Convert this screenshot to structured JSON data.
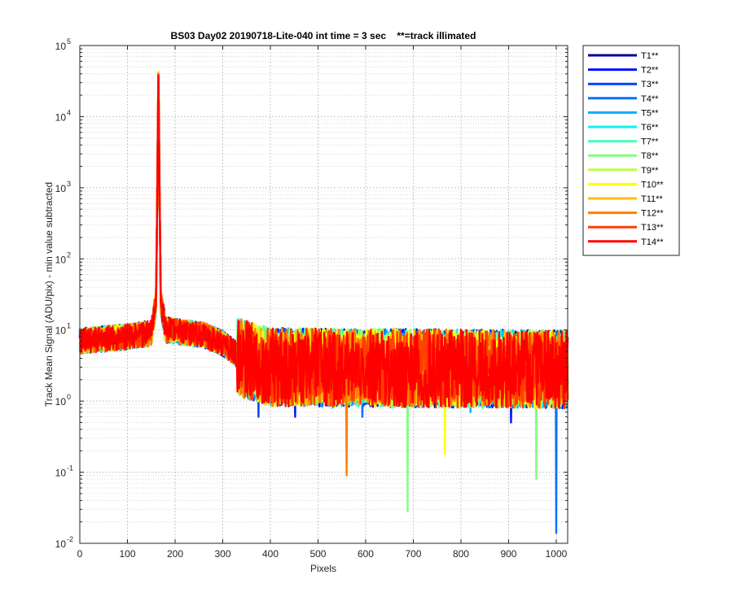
{
  "chart_data": {
    "type": "line",
    "title": "BS03 Day02 20190718-Lite-040 int time = 3 sec    **=track illimated",
    "xlabel": "Pixels",
    "ylabel": "Track Mean Signal (ADU/pix) - min value subtracted",
    "xlim": [
      0,
      1024
    ],
    "ylim": [
      0.01,
      100000
    ],
    "yscale": "log",
    "x_ticks": [
      "0",
      "100",
      "200",
      "300",
      "400",
      "500",
      "600",
      "700",
      "800",
      "900",
      "1000"
    ],
    "y_tick_values": [
      0.01,
      0.1,
      1,
      10,
      100,
      1000,
      10000,
      100000
    ],
    "y_tick_exponents": [
      "-2",
      "-1",
      "0",
      "1",
      "2",
      "3",
      "4",
      "5"
    ],
    "y_tick_base": "10",
    "grid": true,
    "minor_grid": true,
    "legend_position": "outside-right-top",
    "peak": {
      "x": 165,
      "y": 20000
    },
    "profile": [
      {
        "x": 0,
        "y": 7
      },
      {
        "x": 100,
        "y": 8
      },
      {
        "x": 150,
        "y": 9
      },
      {
        "x": 160,
        "y": 25
      },
      {
        "x": 165,
        "y": 20000
      },
      {
        "x": 170,
        "y": 25
      },
      {
        "x": 180,
        "y": 10
      },
      {
        "x": 260,
        "y": 8.5
      },
      {
        "x": 300,
        "y": 6.5
      },
      {
        "x": 340,
        "y": 4
      },
      {
        "x": 400,
        "y": 3
      },
      {
        "x": 1024,
        "y": 2.8
      }
    ],
    "series": [
      {
        "name": "T1**",
        "color": "#00008f",
        "peak": 20000,
        "dips": []
      },
      {
        "name": "T2**",
        "color": "#0010ff",
        "peak": 19000,
        "dips": [
          {
            "x": 452,
            "y": 0.6
          },
          {
            "x": 905,
            "y": 0.5
          }
        ]
      },
      {
        "name": "T3**",
        "color": "#0040ff",
        "peak": 18500,
        "dips": [
          {
            "x": 375,
            "y": 0.6
          }
        ]
      },
      {
        "name": "T4**",
        "color": "#0070ff",
        "peak": 19500,
        "dips": [
          {
            "x": 1000,
            "y": 0.014
          },
          {
            "x": 593,
            "y": 0.6
          }
        ]
      },
      {
        "name": "T5**",
        "color": "#00b0ff",
        "peak": 20500,
        "dips": [
          {
            "x": 820,
            "y": 0.7
          }
        ]
      },
      {
        "name": "T6**",
        "color": "#10f0ef",
        "peak": 19000,
        "dips": [
          {
            "x": 530,
            "y": 0.8
          }
        ]
      },
      {
        "name": "T7**",
        "color": "#40ffbf",
        "peak": 21000,
        "dips": []
      },
      {
        "name": "T8**",
        "color": "#80ff80",
        "peak": 20000,
        "dips": [
          {
            "x": 688,
            "y": 0.028
          },
          {
            "x": 958,
            "y": 0.08
          }
        ]
      },
      {
        "name": "T9**",
        "color": "#bfff40",
        "peak": 22000,
        "dips": []
      },
      {
        "name": "T10**",
        "color": "#ffff00",
        "peak": 23000,
        "dips": [
          {
            "x": 766,
            "y": 0.18
          }
        ]
      },
      {
        "name": "T11**",
        "color": "#ffbf00",
        "peak": 21500,
        "dips": []
      },
      {
        "name": "T12**",
        "color": "#ff7f00",
        "peak": 20000,
        "dips": [
          {
            "x": 560,
            "y": 0.09
          }
        ]
      },
      {
        "name": "T13**",
        "color": "#ff3f00",
        "peak": 19000,
        "dips": []
      },
      {
        "name": "T14**",
        "color": "#ff0000",
        "peak": 18000,
        "dips": []
      }
    ]
  }
}
